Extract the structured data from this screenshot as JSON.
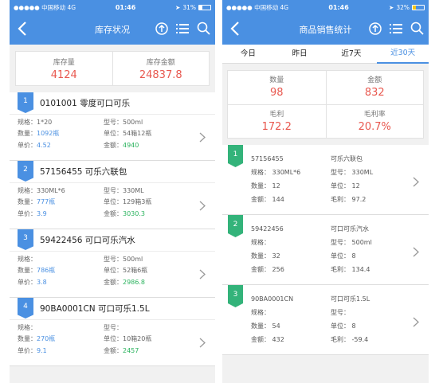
{
  "left": {
    "status": {
      "carrier": "●●●●● 中国移动  4G",
      "time": "01:46",
      "battery": "31%"
    },
    "title": "库存状况",
    "summary": [
      {
        "label": "库存量",
        "value": "4124"
      },
      {
        "label": "库存金额",
        "value": "24837.8"
      }
    ],
    "items": [
      {
        "no": "1",
        "title": "0101001  零度可口可乐",
        "spec": "规格：1*20",
        "model": "型号：500ml",
        "qty_label": "数量：",
        "qty": "1092瓶",
        "unit_label": "单位：",
        "unit": "54箱12瓶",
        "price_label": "单价：",
        "price": "4.52",
        "amount_label": "金额：",
        "amount": "4940"
      },
      {
        "no": "2",
        "title": "57156455  可乐六联包",
        "spec": "规格：330ML*6",
        "model": "型号：330ML",
        "qty_label": "数量：",
        "qty": "777瓶",
        "unit_label": "单位：",
        "unit": "129箱3瓶",
        "price_label": "单价：",
        "price": "3.9",
        "amount_label": "金额：",
        "amount": "3030.3"
      },
      {
        "no": "3",
        "title": "59422456  可口可乐汽水",
        "spec": "规格：",
        "model": "型号：500ml",
        "qty_label": "数量：",
        "qty": "786瓶",
        "unit_label": "单位：",
        "unit": "52箱6瓶",
        "price_label": "单价：",
        "price": "3.8",
        "amount_label": "金额：",
        "amount": "2986.8"
      },
      {
        "no": "4",
        "title": "90BA0001CN  可口可乐1.5L",
        "spec": "规格：",
        "model": "型号：",
        "qty_label": "数量：",
        "qty": "270瓶",
        "unit_label": "单位：",
        "unit": "10箱20瓶",
        "price_label": "单价：",
        "price": "9.1",
        "amount_label": "金额：",
        "amount": "2457"
      }
    ]
  },
  "right": {
    "status": {
      "carrier": "●●●●● 中国移动  4G",
      "time": "01:46",
      "battery": "32%"
    },
    "title": "商品销售统计",
    "tabs": [
      "今日",
      "昨日",
      "近7天",
      "近30天"
    ],
    "summary": [
      {
        "label": "数量",
        "value": "98"
      },
      {
        "label": "金额",
        "value": "832"
      },
      {
        "label": "毛利",
        "value": "172.2"
      },
      {
        "label": "毛利率",
        "value": "20.7%"
      }
    ],
    "items": [
      {
        "no": "1",
        "code": "57156455",
        "name": "可乐六联包",
        "spec": "规格：  330ML*6",
        "model": "型号：  330ML",
        "qty": "数量：  12",
        "unit": "单位：  12",
        "amount": "金额：  144",
        "profit": "毛利：  97.2"
      },
      {
        "no": "2",
        "code": "59422456",
        "name": "可口可乐汽水",
        "spec": "规格：",
        "model": "型号：  500ml",
        "qty": "数量：  32",
        "unit": "单位：  8",
        "amount": "金额：  256",
        "profit": "毛利：  134.4"
      },
      {
        "no": "3",
        "code": "90BA0001CN",
        "name": "可口可乐1.5L",
        "spec": "规格：",
        "model": "型号：",
        "qty": "数量：  54",
        "unit": "单位：  8",
        "amount": "金额：  432",
        "profit": "毛利：  -59.4"
      }
    ]
  }
}
